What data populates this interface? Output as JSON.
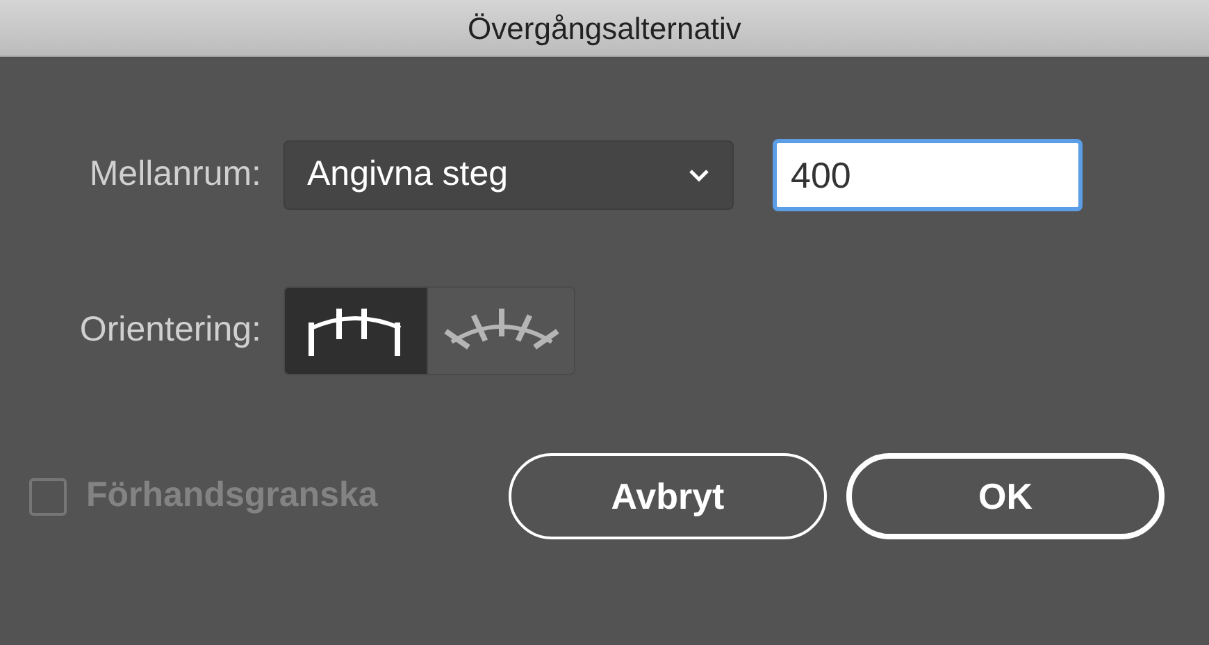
{
  "window": {
    "title": "Övergångsalternativ"
  },
  "spacing": {
    "label": "Mellanrum:",
    "mode": "Angivna steg",
    "value": "400"
  },
  "orientation": {
    "label": "Orientering:",
    "options": [
      {
        "kind": "page",
        "selected": true
      },
      {
        "kind": "path",
        "selected": false
      }
    ]
  },
  "preview": {
    "label": "Förhandsgranska",
    "checked": false,
    "disabled": true
  },
  "buttons": [
    {
      "label": "Avbryt",
      "default": false
    },
    {
      "label": "OK",
      "default": true
    }
  ]
}
